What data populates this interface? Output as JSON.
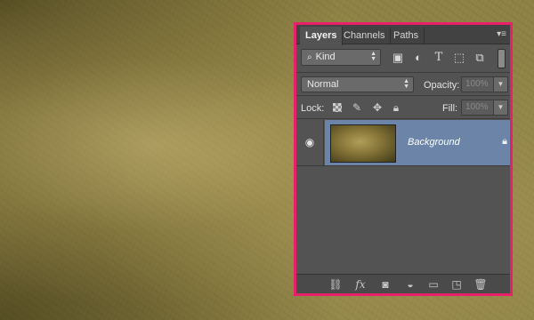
{
  "panel": {
    "tabs": [
      {
        "label": "Layers",
        "active": true
      },
      {
        "label": "Channels",
        "active": false
      },
      {
        "label": "Paths",
        "active": false
      }
    ],
    "menu_icon": "panel-menu-icon"
  },
  "filter": {
    "kind_label": "Kind",
    "icons": [
      "pixel-filter-icon",
      "adjustment-filter-icon",
      "type-filter-icon",
      "shape-filter-icon",
      "smart-object-filter-icon"
    ]
  },
  "blend": {
    "mode": "Normal",
    "opacity_label": "Opacity:",
    "opacity_value": "100%"
  },
  "lock": {
    "label": "Lock:",
    "fill_label": "Fill:",
    "fill_value": "100%"
  },
  "layers": [
    {
      "name": "Background",
      "visible": true,
      "locked": true,
      "selected": true
    }
  ],
  "footer_icons": [
    "link-layers-icon",
    "fx-icon",
    "layer-mask-icon",
    "adjustment-layer-icon",
    "new-group-icon",
    "new-layer-icon",
    "delete-layer-icon"
  ],
  "colors": {
    "highlight_border": "#e8206a",
    "selected_layer": "#6c84a8",
    "panel_bg": "#535353"
  }
}
